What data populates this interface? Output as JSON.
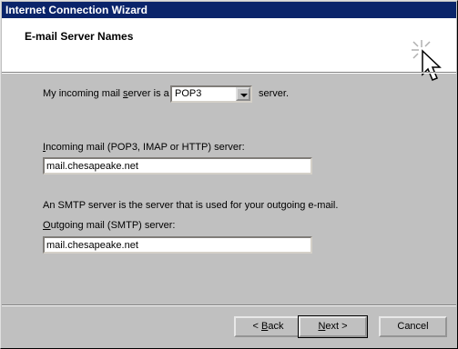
{
  "window": {
    "title": "Internet Connection Wizard"
  },
  "header": {
    "title": "E-mail Server Names",
    "icon": "wizard-cursor-icon"
  },
  "server_type": {
    "label_prefix": "My incoming mail ",
    "label_accel": "s",
    "label_suffix": "erver is a",
    "selected": "POP3",
    "after_text": "server."
  },
  "incoming": {
    "label_accel": "I",
    "label_rest": "ncoming mail (POP3, IMAP or HTTP) server:",
    "value": "mail.chesapeake.net"
  },
  "smtp_info": "An SMTP server is the server that is used for your outgoing e-mail.",
  "outgoing": {
    "label_accel": "O",
    "label_rest": "utgoing mail (SMTP) server:",
    "value": "mail.chesapeake.net"
  },
  "buttons": {
    "back_prefix": "< ",
    "back_accel": "B",
    "back_rest": "ack",
    "next_accel": "N",
    "next_rest": "ext >",
    "cancel": "Cancel"
  }
}
